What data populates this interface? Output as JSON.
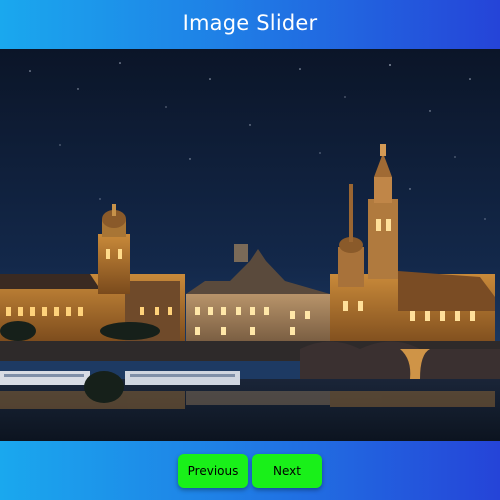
{
  "header": {
    "title": "Image Slider"
  },
  "slider": {
    "image_subject": "night-city-skyline-photo"
  },
  "controls": {
    "previous_label": "Previous",
    "next_label": "Next"
  },
  "colors": {
    "header_gradient_start": "#1aa8ee",
    "header_gradient_end": "#2544d8",
    "button_bg": "#19f019"
  }
}
